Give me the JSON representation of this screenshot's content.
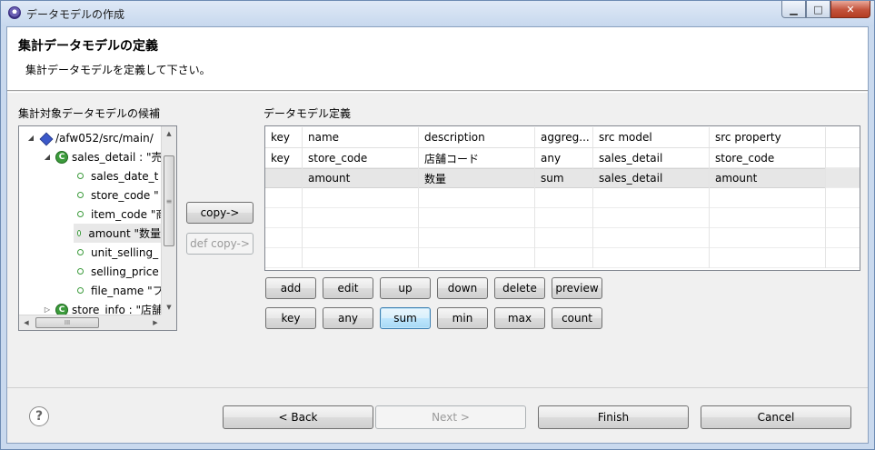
{
  "window": {
    "title": "データモデルの作成",
    "buttons": [
      "minimize",
      "maximize",
      "close"
    ]
  },
  "header": {
    "title": "集計データモデルの定義",
    "description": "集計データモデルを定義して下さい。"
  },
  "left": {
    "label": "集計対象データモデルの候補",
    "tree": [
      {
        "text": "/afw052/src/main/",
        "icon": "package-icon",
        "arrow": "◢"
      },
      {
        "text": "sales_detail : \"売",
        "icon": "class-icon",
        "arrow": "◢"
      },
      {
        "text": "sales_date_t",
        "icon": "field-icon"
      },
      {
        "text": "store_code \"",
        "icon": "field-icon"
      },
      {
        "text": "item_code \"商",
        "icon": "field-icon"
      },
      {
        "text": "amount \"数量",
        "icon": "field-icon",
        "selected": true
      },
      {
        "text": "unit_selling_",
        "icon": "field-icon"
      },
      {
        "text": "selling_price",
        "icon": "field-icon"
      },
      {
        "text": "file_name \"フ",
        "icon": "field-icon"
      },
      {
        "text": "store_info : \"店舗",
        "icon": "class-icon",
        "arrow": "▷"
      }
    ]
  },
  "middle": {
    "copy_label": "copy->",
    "def_copy_label": "def copy->"
  },
  "right": {
    "label": "データモデル定義",
    "columns": [
      "key",
      "name",
      "description",
      "aggreg...",
      "src model",
      "src property"
    ],
    "rows": [
      [
        "key",
        "store_code",
        "店舗コード",
        "any",
        "sales_detail",
        "store_code"
      ],
      [
        "",
        "amount",
        "数量",
        "sum",
        "sales_detail",
        "amount"
      ]
    ]
  },
  "actions_row1": [
    "add",
    "edit",
    "up",
    "down",
    "delete",
    "preview"
  ],
  "actions_row2": [
    "key",
    "any",
    "sum",
    "min",
    "max",
    "count"
  ],
  "footer": {
    "back_label": "< Back",
    "back_mnemonic": "B",
    "next_label": "Next >",
    "finish_label": "Finish",
    "cancel_label": "Cancel"
  }
}
